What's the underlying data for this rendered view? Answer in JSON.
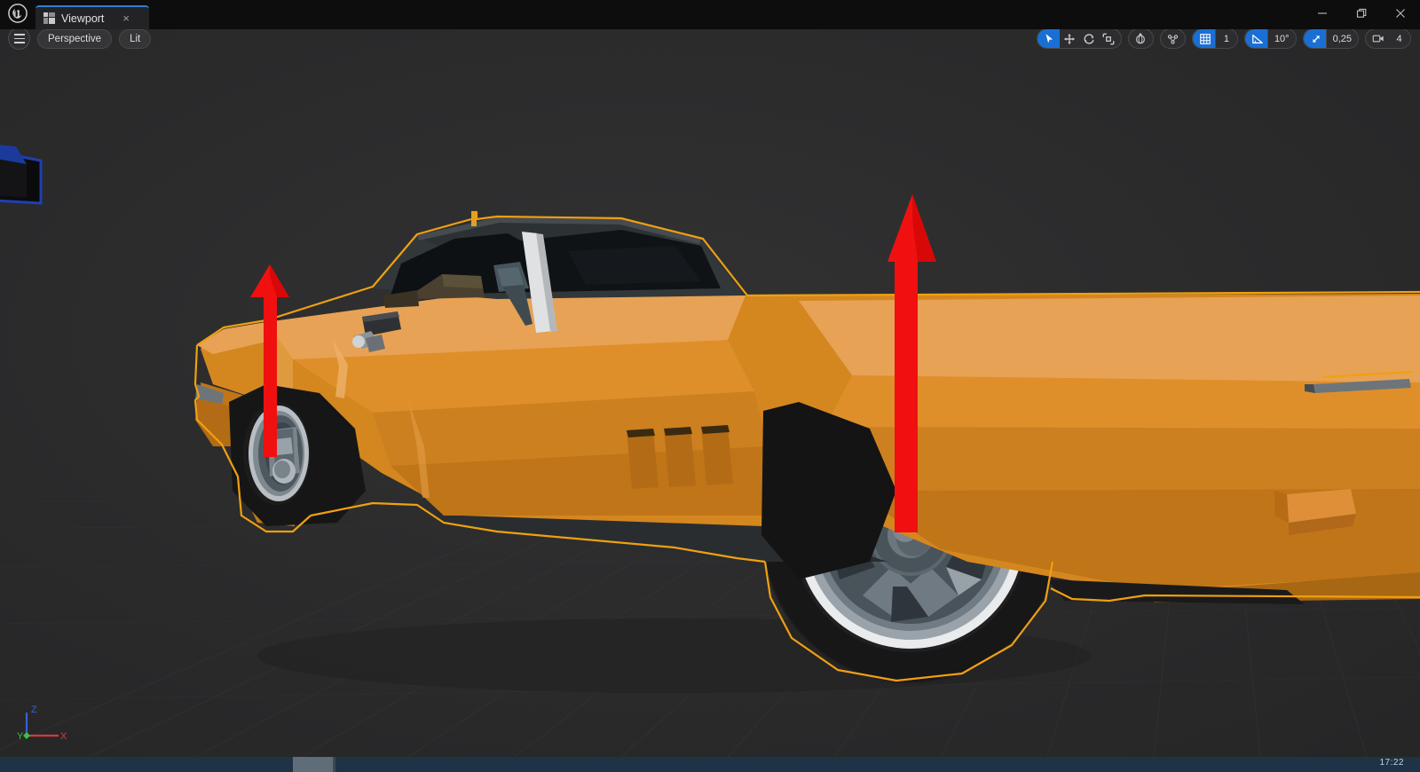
{
  "window": {
    "app_logo": "unreal-engine-logo",
    "tab": {
      "label": "Viewport",
      "close": "×",
      "icon": "viewport-grid-icon"
    },
    "controls": {
      "minimize": "minimize-icon",
      "maximize": "maximize-icon",
      "close": "close-icon"
    }
  },
  "viewport_toolbar_left": {
    "menu_label": "viewport-menu-icon",
    "view_mode": "Perspective",
    "shading_mode": "Lit"
  },
  "viewport_toolbar_right": {
    "transform_tools": [
      {
        "name": "select-tool",
        "icon": "cursor-arrow-icon",
        "active": true
      },
      {
        "name": "translate-tool",
        "icon": "move-arrows-icon",
        "active": false
      },
      {
        "name": "rotate-tool",
        "icon": "rotate-icon",
        "active": false
      },
      {
        "name": "scale-tool",
        "icon": "scale-icon",
        "active": false
      }
    ],
    "coordinate_system": {
      "name": "world-coordinate-toggle",
      "icon": "globe-axis-icon",
      "active": false
    },
    "surface_snap": {
      "name": "surface-snap-toggle",
      "icon": "surface-snap-icon",
      "active": false
    },
    "grid_snap": {
      "name": "grid-snap-toggle",
      "icon": "grid-icon",
      "active": true,
      "value": "1"
    },
    "angle_snap": {
      "name": "angle-snap-toggle",
      "icon": "angle-icon",
      "active": true,
      "value": "10°"
    },
    "scale_snap": {
      "name": "scale-snap-toggle",
      "icon": "diagonal-arrow-icon",
      "active": true,
      "value": "0,25"
    },
    "camera_speed": {
      "name": "camera-speed",
      "icon": "camera-icon",
      "active": false,
      "value": "4"
    }
  },
  "axis_gizmo": {
    "x": {
      "label": "X",
      "color": "#d63a3a"
    },
    "y": {
      "label": "Y",
      "color": "#3fbf3f"
    },
    "z": {
      "label": "Z",
      "color": "#3a5fd6"
    }
  },
  "scene": {
    "selected_actor": "sports-car-mesh",
    "selection_outline_color": "#f0a010",
    "secondary_outline_color": "#1f3fb0",
    "car_colors": {
      "body_light": "#e7a255",
      "body_mid": "#df8f2a",
      "body_base": "#d4871f",
      "body_dark": "#c4781a",
      "body_darker": "#b36c15",
      "glass": "#1d2226",
      "cabin_dark": "#32373a",
      "tire": "#1b1b1c",
      "rim_light": "#c9ced2",
      "rim_mid": "#7d878e",
      "rim_dark": "#3f464b",
      "trim_white": "#e4e6e7"
    },
    "arrows": [
      {
        "name": "front-wheel-direction-arrow",
        "color": "#f01010"
      },
      {
        "name": "rear-wheel-direction-arrow",
        "color": "#f01010"
      }
    ],
    "background": "#2b2b2c"
  },
  "taskbar": {
    "clock": "17:22"
  }
}
